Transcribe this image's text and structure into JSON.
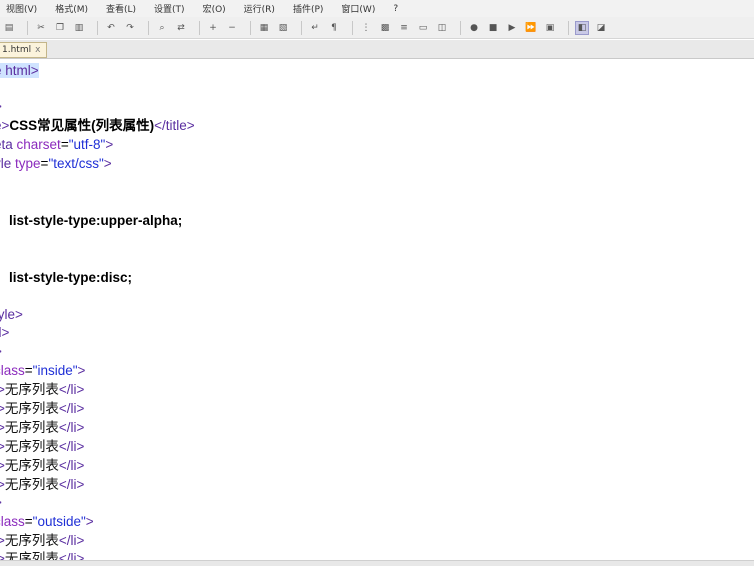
{
  "menu": [
    "视图(V)",
    "格式(M)",
    "查看(L)",
    "设置(T)",
    "宏(O)",
    "运行(R)",
    "插件(P)",
    "窗口(W)",
    "?"
  ],
  "tab": {
    "label": "1.html",
    "close": "x"
  },
  "code": {
    "l1": "e html>",
    "l2": ">",
    "l3_a": "e>",
    "l3_b": "CSS常见属性(列表属性)",
    "l3_c": "</title>",
    "l4_a": "eta ",
    "l4_b": "charset",
    "l4_c": "=",
    "l4_d": "\"utf-8\"",
    "l4_e": ">",
    "l5_a": "yle ",
    "l5_b": "type",
    "l5_c": "=",
    "l5_d": "\"text/css\"",
    "l5_e": ">",
    "l6": "{",
    "l7": "    list-style-type:upper-alpha;",
    "l8": "{",
    "l9": "    list-style-type:disc;",
    "l10": "tyle>",
    "l11": "d>",
    "l12": ">",
    "l13_a": "class",
    "l13_b": "=",
    "l13_c": "\"inside\"",
    "l13_d": ">",
    "li_open": "i>",
    "li_text": "无序列表",
    "li_close": "</li>",
    "l20": ">",
    "l21_a": "class",
    "l21_b": "=",
    "l21_c": "\"outside\"",
    "l21_d": ">"
  }
}
